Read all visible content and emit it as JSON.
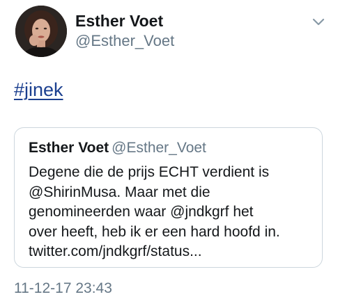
{
  "author": {
    "display_name": "Esther Voet",
    "handle": "@Esther_Voet",
    "avatar_icon": "profile-photo"
  },
  "menu": {
    "icon": "chevron-down-icon"
  },
  "tweet": {
    "hashtag": "#jinek"
  },
  "quoted_tweet": {
    "display_name": "Esther Voet",
    "handle": "@Esther_Voet",
    "text_lines": [
      "Degene die de prijs ECHT verdient is",
      "@ShirinMusa. Maar met die",
      "genomineerden waar @jndkgrf het",
      "over heeft, heb ik er een hard hoofd in.",
      "twitter.com/jndkgrf/status..."
    ]
  },
  "timestamp": "11-12-17 23:43",
  "colors": {
    "link": "#1b3f8f",
    "secondary_text": "#657786",
    "border": "#ccd6dd"
  }
}
